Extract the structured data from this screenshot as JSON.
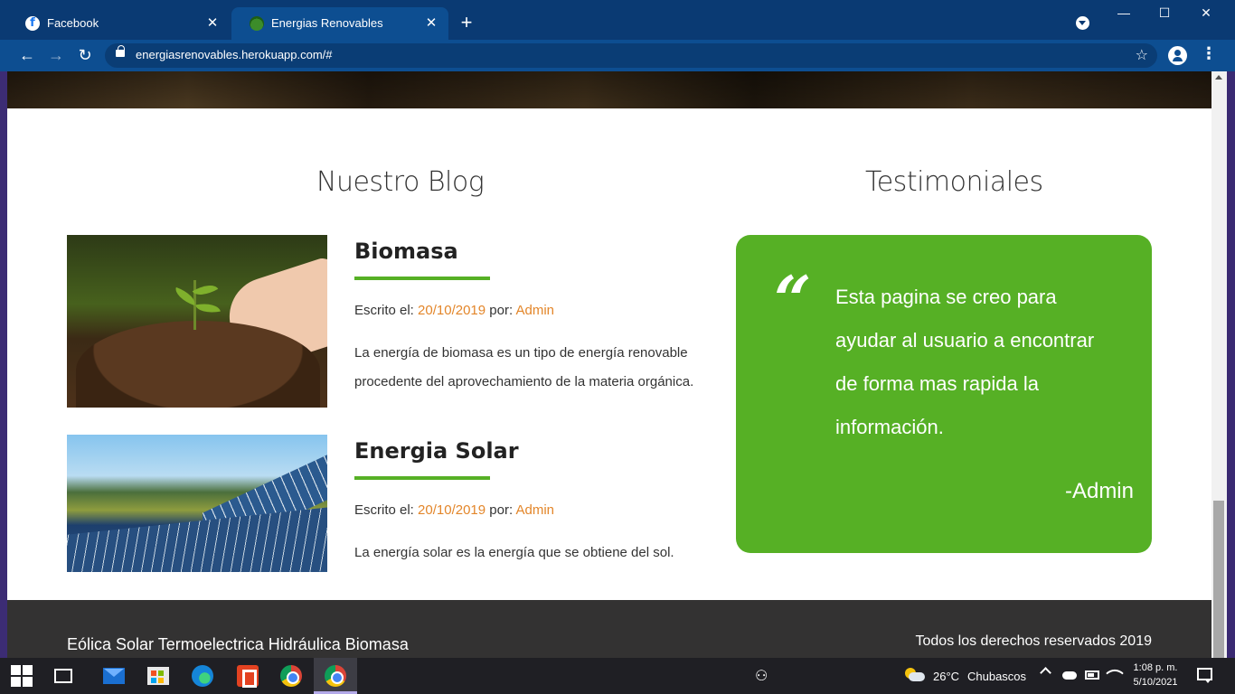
{
  "browser": {
    "tabs": [
      {
        "title": "Facebook",
        "icon": "facebook-icon"
      },
      {
        "title": "Energias Renovables",
        "icon": "eco-leaf-icon"
      }
    ],
    "new_tab": "+",
    "url": "energiasrenovables.herokuapp.com/#"
  },
  "blog": {
    "title": "Nuestro Blog",
    "posts": [
      {
        "title": "Biomasa",
        "written_label": "Escrito el:",
        "date": "20/10/2019",
        "by_label": "por:",
        "author": "Admin",
        "body": "La energía de biomasa es un tipo de energía renovable procedente del aprovechamiento de la materia orgánica."
      },
      {
        "title": "Energia Solar",
        "written_label": "Escrito el:",
        "date": "20/10/2019",
        "by_label": "por:",
        "author": "Admin",
        "body": "La energía solar es la energía que se obtiene del sol."
      }
    ]
  },
  "testimonials": {
    "title": "Testimoniales",
    "quote_mark": "“",
    "quote": "Esta pagina se creo para ayudar al usuario a encontrar de forma mas rapida la información.",
    "author": "-Admin"
  },
  "footer": {
    "categories": "Eólica Solar Termoelectrica Hidráulica Biomasa",
    "copyright": "Todos los derechos reservados 2019"
  },
  "taskbar": {
    "weather_temp": "26°C",
    "weather_desc": "Chubascos",
    "time": "1:08 p. m.",
    "date": "5/10/2021"
  },
  "colors": {
    "accent_green": "#56b025",
    "link_orange": "#e3862a",
    "footer_bg": "#333232",
    "chrome_blue": "#0d4e91"
  }
}
